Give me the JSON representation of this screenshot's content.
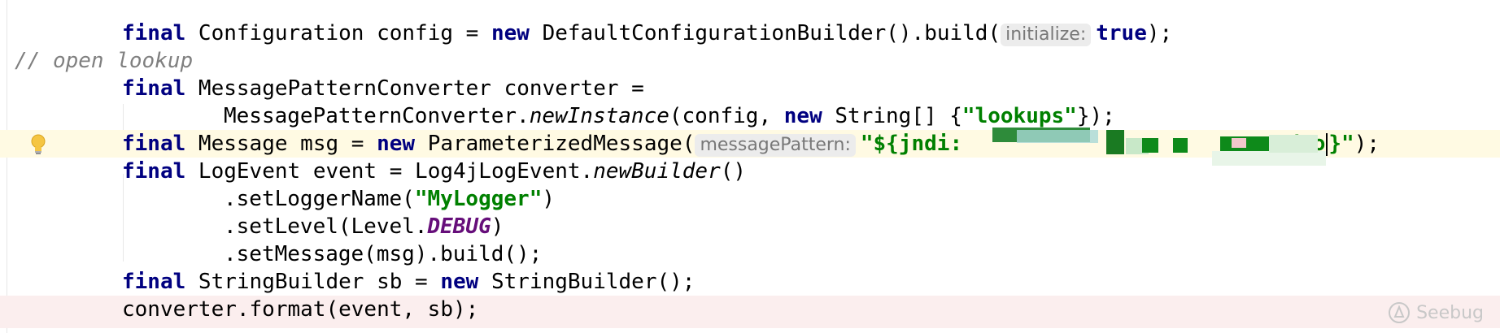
{
  "editor": {
    "lines": [
      {
        "kw1": "final",
        "t1": " Configuration config = ",
        "kw2": "new",
        "t2": " DefaultConfigurationBuilder().build(",
        "hint": "initialize:",
        "kw3": "true",
        "t3": ");"
      },
      {
        "comment": "// open lookup"
      },
      {
        "kw1": "final",
        "t1": " MessagePatternConverter converter ="
      },
      {
        "t1": "MessagePatternConverter.",
        "method": "newInstance",
        "t2": "(config, ",
        "kw1": "new",
        "t3": " String[] {",
        "str": "\"lookups\"",
        "t4": "});"
      },
      {
        "kw1": "final",
        "t1": " Message msg = ",
        "kw2": "new",
        "t2": " ParameterizedMessage(",
        "hint": "messagePattern:",
        "str1": "\"${jndi:",
        "str2": "endoo",
        "str3": "}\"",
        "t3": ");"
      },
      {
        "kw1": "final",
        "t1": " LogEvent event = Log4jLogEvent.",
        "method": "newBuilder",
        "t2": "()"
      },
      {
        "t1": ".setLoggerName(",
        "str": "\"MyLogger\"",
        "t2": ")"
      },
      {
        "t1": ".setLevel(Level.",
        "const": "DEBUG",
        "t2": ")"
      },
      {
        "t1": ".setMessage(msg).build();"
      },
      {
        "kw1": "final",
        "t1": " StringBuilder sb = ",
        "kw2": "new",
        "t2": " StringBuilder();"
      },
      {
        "t1": "converter.format(event, sb);"
      }
    ]
  },
  "watermark": {
    "text": "Seebug",
    "icon": "seebug-logo-icon"
  },
  "colors": {
    "keyword": "#000080",
    "string": "#008000",
    "comment": "#808080",
    "constant": "#660e7a",
    "caret_row": "#fffae3",
    "error_row": "#fbeeee"
  }
}
